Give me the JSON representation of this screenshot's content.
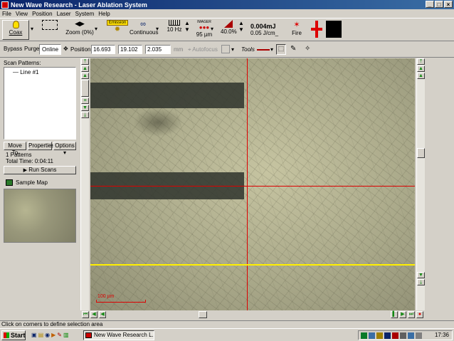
{
  "window": {
    "title": "New Wave Research - Laser Ablation System"
  },
  "menu": [
    "File",
    "View",
    "Position",
    "Laser",
    "System",
    "Help"
  ],
  "toolbar1": {
    "coax": "Coax",
    "zoom": "Zoom (0%)",
    "emission": "Emission",
    "mode": "Continuous",
    "rate": "10 Hz",
    "imager": "IMAGER",
    "spot": "95 µm",
    "energy_pct": "40.0%",
    "energy": "0.004mJ",
    "fluence": "0.05 J/cm_",
    "fire": "Fire"
  },
  "toolbar2": {
    "tabs": [
      "Bypass",
      "Purge",
      "Online"
    ],
    "active_tab": "Online",
    "position_label": "Position:",
    "pos_x": "16.693",
    "pos_y": "19.102",
    "pos_z": "2.035",
    "units": "mm",
    "autofocus": "Autofocus",
    "tools": "Tools"
  },
  "left_panel": {
    "scan_patterns_label": "Scan Patterns:",
    "patterns": [
      "Line #1"
    ],
    "move_to": "Move To",
    "properties": "Properties",
    "options": "Options",
    "count": "1 Patterns",
    "total_time": "Total Time: 0:04:11",
    "run_scans": "Run Scans",
    "sample_map": "Sample Map"
  },
  "camera": {
    "scale_label": "100 µm"
  },
  "status": "Click on corners to define selection area",
  "taskbar": {
    "start": "Start",
    "task": "New Wave Research L...",
    "clock": "17:36"
  },
  "colors": {
    "crosshair": "#dd0000",
    "selection": "#ffef00",
    "titlebar": "#0a246a"
  }
}
